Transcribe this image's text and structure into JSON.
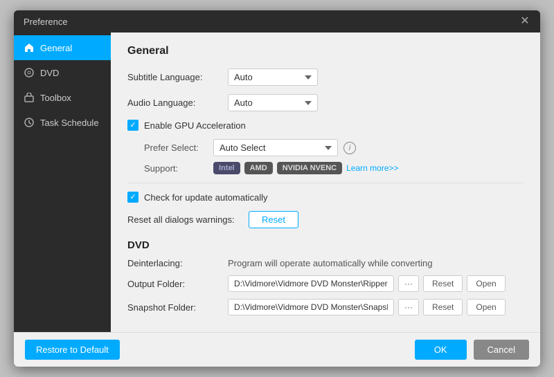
{
  "dialog": {
    "title": "Preference",
    "close_label": "✕"
  },
  "sidebar": {
    "items": [
      {
        "id": "general",
        "label": "General",
        "active": true
      },
      {
        "id": "dvd",
        "label": "DVD",
        "active": false
      },
      {
        "id": "toolbox",
        "label": "Toolbox",
        "active": false
      },
      {
        "id": "task-schedule",
        "label": "Task Schedule",
        "active": false
      }
    ]
  },
  "main": {
    "section_general": "General",
    "subtitle_language_label": "Subtitle Language:",
    "subtitle_language_value": "Auto",
    "audio_language_label": "Audio Language:",
    "audio_language_value": "Auto",
    "gpu_checkbox_label": "Enable GPU Acceleration",
    "prefer_select_label": "Prefer Select:",
    "prefer_select_value": "Auto Select",
    "support_label": "Support:",
    "support_intel": "Intel",
    "support_amd": "AMD",
    "support_nvidia": "NVIDIA NVENC",
    "learn_more": "Learn more>>",
    "check_update_label": "Check for update automatically",
    "reset_dialogs_label": "Reset all dialogs warnings:",
    "reset_button": "Reset",
    "section_dvd": "DVD",
    "deinterlacing_label": "Deinterlacing:",
    "deinterlacing_value": "Program will operate automatically while converting",
    "output_folder_label": "Output Folder:",
    "output_folder_value": "D:\\Vidmore\\Vidmore DVD Monster\\Ripper",
    "snapshot_folder_label": "Snapshot Folder:",
    "snapshot_folder_value": "D:\\Vidmore\\Vidmore DVD Monster\\Snapshot",
    "dots_label": "···",
    "reset_folder_label": "Reset",
    "open_label": "Open"
  },
  "footer": {
    "restore_button": "Restore to Default",
    "ok_button": "OK",
    "cancel_button": "Cancel"
  },
  "colors": {
    "accent": "#00aaff",
    "sidebar_bg": "#2b2b2b",
    "sidebar_text": "#cccccc",
    "active_bg": "#00aaff"
  }
}
